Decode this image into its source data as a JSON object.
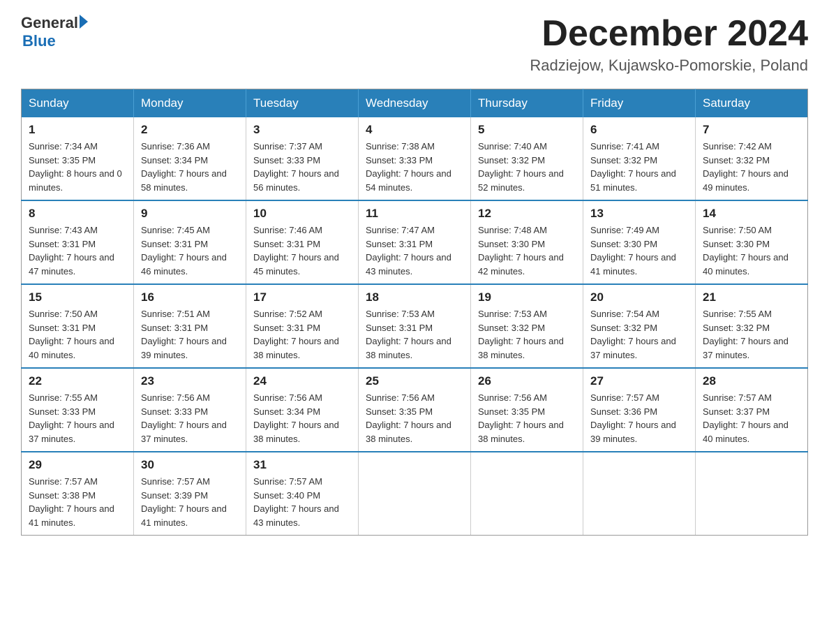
{
  "logo": {
    "general": "General",
    "arrow": "▶",
    "blue": "Blue"
  },
  "title": {
    "month": "December 2024",
    "location": "Radziejow, Kujawsko-Pomorskie, Poland"
  },
  "days_of_week": [
    "Sunday",
    "Monday",
    "Tuesday",
    "Wednesday",
    "Thursday",
    "Friday",
    "Saturday"
  ],
  "weeks": [
    [
      {
        "day": "1",
        "sunrise": "7:34 AM",
        "sunset": "3:35 PM",
        "daylight": "8 hours and 0 minutes."
      },
      {
        "day": "2",
        "sunrise": "7:36 AM",
        "sunset": "3:34 PM",
        "daylight": "7 hours and 58 minutes."
      },
      {
        "day": "3",
        "sunrise": "7:37 AM",
        "sunset": "3:33 PM",
        "daylight": "7 hours and 56 minutes."
      },
      {
        "day": "4",
        "sunrise": "7:38 AM",
        "sunset": "3:33 PM",
        "daylight": "7 hours and 54 minutes."
      },
      {
        "day": "5",
        "sunrise": "7:40 AM",
        "sunset": "3:32 PM",
        "daylight": "7 hours and 52 minutes."
      },
      {
        "day": "6",
        "sunrise": "7:41 AM",
        "sunset": "3:32 PM",
        "daylight": "7 hours and 51 minutes."
      },
      {
        "day": "7",
        "sunrise": "7:42 AM",
        "sunset": "3:32 PM",
        "daylight": "7 hours and 49 minutes."
      }
    ],
    [
      {
        "day": "8",
        "sunrise": "7:43 AM",
        "sunset": "3:31 PM",
        "daylight": "7 hours and 47 minutes."
      },
      {
        "day": "9",
        "sunrise": "7:45 AM",
        "sunset": "3:31 PM",
        "daylight": "7 hours and 46 minutes."
      },
      {
        "day": "10",
        "sunrise": "7:46 AM",
        "sunset": "3:31 PM",
        "daylight": "7 hours and 45 minutes."
      },
      {
        "day": "11",
        "sunrise": "7:47 AM",
        "sunset": "3:31 PM",
        "daylight": "7 hours and 43 minutes."
      },
      {
        "day": "12",
        "sunrise": "7:48 AM",
        "sunset": "3:30 PM",
        "daylight": "7 hours and 42 minutes."
      },
      {
        "day": "13",
        "sunrise": "7:49 AM",
        "sunset": "3:30 PM",
        "daylight": "7 hours and 41 minutes."
      },
      {
        "day": "14",
        "sunrise": "7:50 AM",
        "sunset": "3:30 PM",
        "daylight": "7 hours and 40 minutes."
      }
    ],
    [
      {
        "day": "15",
        "sunrise": "7:50 AM",
        "sunset": "3:31 PM",
        "daylight": "7 hours and 40 minutes."
      },
      {
        "day": "16",
        "sunrise": "7:51 AM",
        "sunset": "3:31 PM",
        "daylight": "7 hours and 39 minutes."
      },
      {
        "day": "17",
        "sunrise": "7:52 AM",
        "sunset": "3:31 PM",
        "daylight": "7 hours and 38 minutes."
      },
      {
        "day": "18",
        "sunrise": "7:53 AM",
        "sunset": "3:31 PM",
        "daylight": "7 hours and 38 minutes."
      },
      {
        "day": "19",
        "sunrise": "7:53 AM",
        "sunset": "3:32 PM",
        "daylight": "7 hours and 38 minutes."
      },
      {
        "day": "20",
        "sunrise": "7:54 AM",
        "sunset": "3:32 PM",
        "daylight": "7 hours and 37 minutes."
      },
      {
        "day": "21",
        "sunrise": "7:55 AM",
        "sunset": "3:32 PM",
        "daylight": "7 hours and 37 minutes."
      }
    ],
    [
      {
        "day": "22",
        "sunrise": "7:55 AM",
        "sunset": "3:33 PM",
        "daylight": "7 hours and 37 minutes."
      },
      {
        "day": "23",
        "sunrise": "7:56 AM",
        "sunset": "3:33 PM",
        "daylight": "7 hours and 37 minutes."
      },
      {
        "day": "24",
        "sunrise": "7:56 AM",
        "sunset": "3:34 PM",
        "daylight": "7 hours and 38 minutes."
      },
      {
        "day": "25",
        "sunrise": "7:56 AM",
        "sunset": "3:35 PM",
        "daylight": "7 hours and 38 minutes."
      },
      {
        "day": "26",
        "sunrise": "7:56 AM",
        "sunset": "3:35 PM",
        "daylight": "7 hours and 38 minutes."
      },
      {
        "day": "27",
        "sunrise": "7:57 AM",
        "sunset": "3:36 PM",
        "daylight": "7 hours and 39 minutes."
      },
      {
        "day": "28",
        "sunrise": "7:57 AM",
        "sunset": "3:37 PM",
        "daylight": "7 hours and 40 minutes."
      }
    ],
    [
      {
        "day": "29",
        "sunrise": "7:57 AM",
        "sunset": "3:38 PM",
        "daylight": "7 hours and 41 minutes."
      },
      {
        "day": "30",
        "sunrise": "7:57 AM",
        "sunset": "3:39 PM",
        "daylight": "7 hours and 41 minutes."
      },
      {
        "day": "31",
        "sunrise": "7:57 AM",
        "sunset": "3:40 PM",
        "daylight": "7 hours and 43 minutes."
      },
      null,
      null,
      null,
      null
    ]
  ]
}
